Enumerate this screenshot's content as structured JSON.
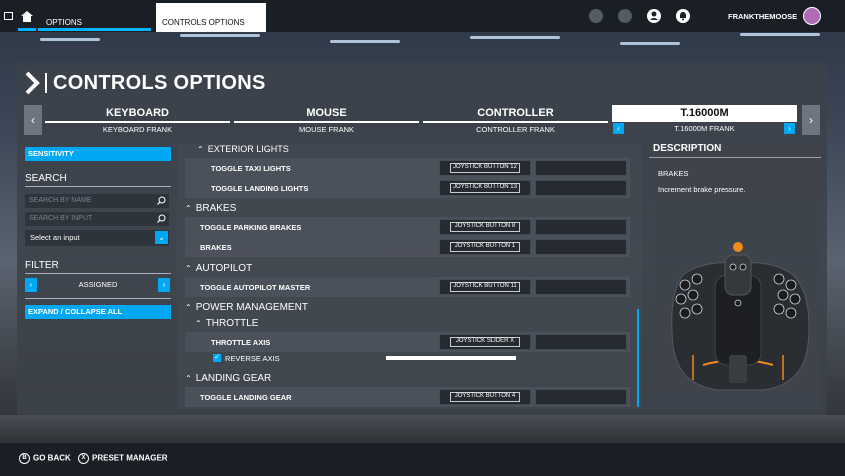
{
  "topbar": {
    "options_label": "OPTIONS",
    "controls_options_label": "CONTROLS OPTIONS",
    "username": "FRANKTHEMOOSE"
  },
  "page": {
    "title": "CONTROLS OPTIONS"
  },
  "devices": [
    {
      "name": "KEYBOARD",
      "profile": "KEYBOARD FRANK"
    },
    {
      "name": "MOUSE",
      "profile": "MOUSE FRANK"
    },
    {
      "name": "CONTROLLER",
      "profile": "CONTROLLER FRANK"
    },
    {
      "name": "T.16000M",
      "profile": "T.16000M FRANK"
    }
  ],
  "sidebar": {
    "sensitivity_label": "SENSITIVITY",
    "search_label": "SEARCH",
    "search_by_name_placeholder": "SEARCH BY NAME",
    "search_by_input_placeholder": "SEARCH BY INPUT",
    "select_input_label": "Select an input",
    "filter_label": "FILTER",
    "filter_value": "ASSIGNED",
    "expand_collapse_label": "EXPAND / COLLAPSE ALL"
  },
  "list": {
    "exterior_lights_cat": "EXTERIOR LIGHTS",
    "toggle_taxi_lights": "TOGGLE TAXI LIGHTS",
    "toggle_taxi_lights_bind": "JOYSTICK BUTTON 12",
    "toggle_landing_lights": "TOGGLE LANDING LIGHTS",
    "toggle_landing_lights_bind": "JOYSTICK BUTTON 13",
    "brakes_cat": "BRAKES",
    "toggle_parking_brakes": "TOGGLE PARKING BRAKES",
    "toggle_parking_brakes_bind": "JOYSTICK BUTTON 8",
    "brakes": "BRAKES",
    "brakes_bind": "JOYSTICK BUTTON 1",
    "autopilot_cat": "AUTOPILOT",
    "toggle_autopilot_master": "TOGGLE AUTOPILOT MASTER",
    "toggle_autopilot_master_bind": "JOYSTICK BUTTON 11",
    "power_management_cat": "POWER MANAGEMENT",
    "throttle_cat": "THROTTLE",
    "throttle_axis": "THROTTLE AXIS",
    "throttle_axis_bind": "JOYSTICK SLIDER X",
    "reverse_axis": "REVERSE AXIS",
    "landing_gear_cat": "LANDING GEAR",
    "toggle_landing_gear": "TOGGLE LANDING GEAR",
    "toggle_landing_gear_bind": "JOYSTICK BUTTON 4"
  },
  "description": {
    "heading": "DESCRIPTION",
    "name": "BRAKES",
    "text": "Increment brake pressure."
  },
  "bottom": {
    "go_back_key": "B",
    "go_back": "GO BACK",
    "preset_manager_key": "X",
    "preset_manager": "PRESET MANAGER"
  },
  "colors": {
    "accent": "#00a8f3",
    "joystick_accent": "#f08a1c"
  }
}
